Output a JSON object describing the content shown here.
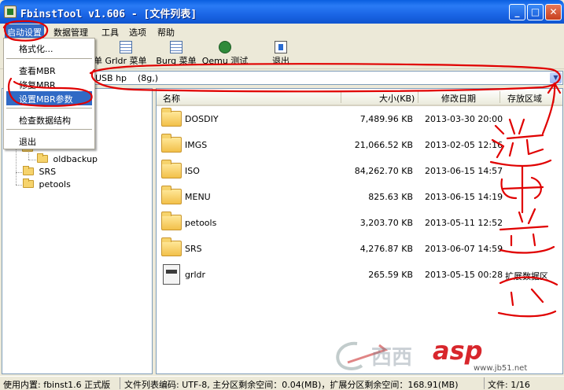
{
  "window": {
    "title": "FbinstTool v1.606 - [文件列表]"
  },
  "menubar": {
    "items": [
      "启动设置",
      "数据管理",
      "工具",
      "选项",
      "帮助"
    ]
  },
  "dropdown": {
    "items": [
      "格式化...",
      "查看MBR",
      "修复MBR",
      "设置MBR参数",
      "检查数据结构",
      "退出"
    ],
    "selected": "设置MBR参数"
  },
  "toolbar": {
    "buttons": [
      "菜单",
      "Grldr 菜单",
      "Burg 菜单",
      "Qemu 测试",
      "退出"
    ]
  },
  "drive": {
    "value": "USB hp    (8g,)"
  },
  "tree": {
    "nodes": [
      "oldbackup",
      "SRS",
      "petools"
    ]
  },
  "list": {
    "columns": [
      "名称",
      "大小(KB)",
      "修改日期",
      "存放区域"
    ],
    "rows": [
      {
        "type": "folder",
        "name": "DOSDIY",
        "size": "7,489.96 KB",
        "date": "2013-03-30 20:00",
        "area": ""
      },
      {
        "type": "folder",
        "name": "IMGS",
        "size": "21,066.52 KB",
        "date": "2013-02-05 12:16",
        "area": ""
      },
      {
        "type": "folder",
        "name": "ISO",
        "size": "84,262.70 KB",
        "date": "2013-06-15 14:57",
        "area": ""
      },
      {
        "type": "folder",
        "name": "MENU",
        "size": "825.63 KB",
        "date": "2013-06-15 14:19",
        "area": ""
      },
      {
        "type": "folder",
        "name": "petools",
        "size": "3,203.70 KB",
        "date": "2013-05-11 12:52",
        "area": ""
      },
      {
        "type": "folder",
        "name": "SRS",
        "size": "4,276.87 KB",
        "date": "2013-06-07 14:59",
        "area": ""
      },
      {
        "type": "file",
        "name": "grldr",
        "size": "265.59 KB",
        "date": "2013-05-15 00:28",
        "area": "扩展数据区"
      }
    ]
  },
  "status": {
    "core": "使用内置: fbinst1.6 正式版",
    "info": "文件列表编码: UTF-8, 主分区剩余空间：0.04(MB)，扩展分区剩余空间：168.91(MB)",
    "count": "文件: 1/16"
  },
  "annotation": {
    "handwritten": "选中U盘",
    "color": "#E00000"
  },
  "watermark": {
    "brand": "asp",
    "site": "www.jb51.net"
  }
}
